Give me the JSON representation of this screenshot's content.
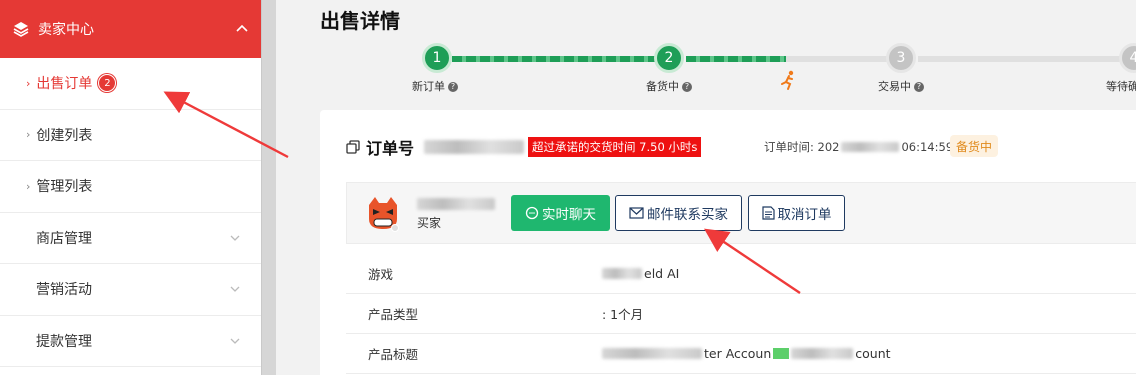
{
  "sidebar": {
    "header": "卖家中心",
    "items": [
      {
        "label": "出售订单",
        "badge": "2"
      },
      {
        "label": "创建列表"
      },
      {
        "label": "管理列表"
      },
      {
        "label": "商店管理"
      },
      {
        "label": "营销活动"
      },
      {
        "label": "提款管理"
      }
    ]
  },
  "page": {
    "title": "出售详情"
  },
  "steps": [
    {
      "num": "1",
      "label": "新订单"
    },
    {
      "num": "2",
      "label": "备货中"
    },
    {
      "num": "3",
      "label": "交易中"
    },
    {
      "num": "4",
      "label": "等待确"
    }
  ],
  "order": {
    "label": "订单号",
    "warning": "超过承诺的交货时间 7.50 小时s",
    "time_label": "订单时间: 202",
    "time_tail": "06:14:59",
    "status": "备货中"
  },
  "buyer": {
    "role": "买家",
    "chat_button": "实时聊天",
    "email_button": "邮件联系买家",
    "cancel_button": "取消订单"
  },
  "details": [
    {
      "key": "游戏",
      "value_tail": "eld AI"
    },
    {
      "key": "产品类型",
      "value_tail": ": 1个月"
    },
    {
      "key": "产品标题",
      "value_mid": "ter Accoun",
      "value_tail": "count"
    }
  ],
  "colors": {
    "accent": "#e53935",
    "success": "#1fb76f",
    "navy": "#1f3a60"
  }
}
